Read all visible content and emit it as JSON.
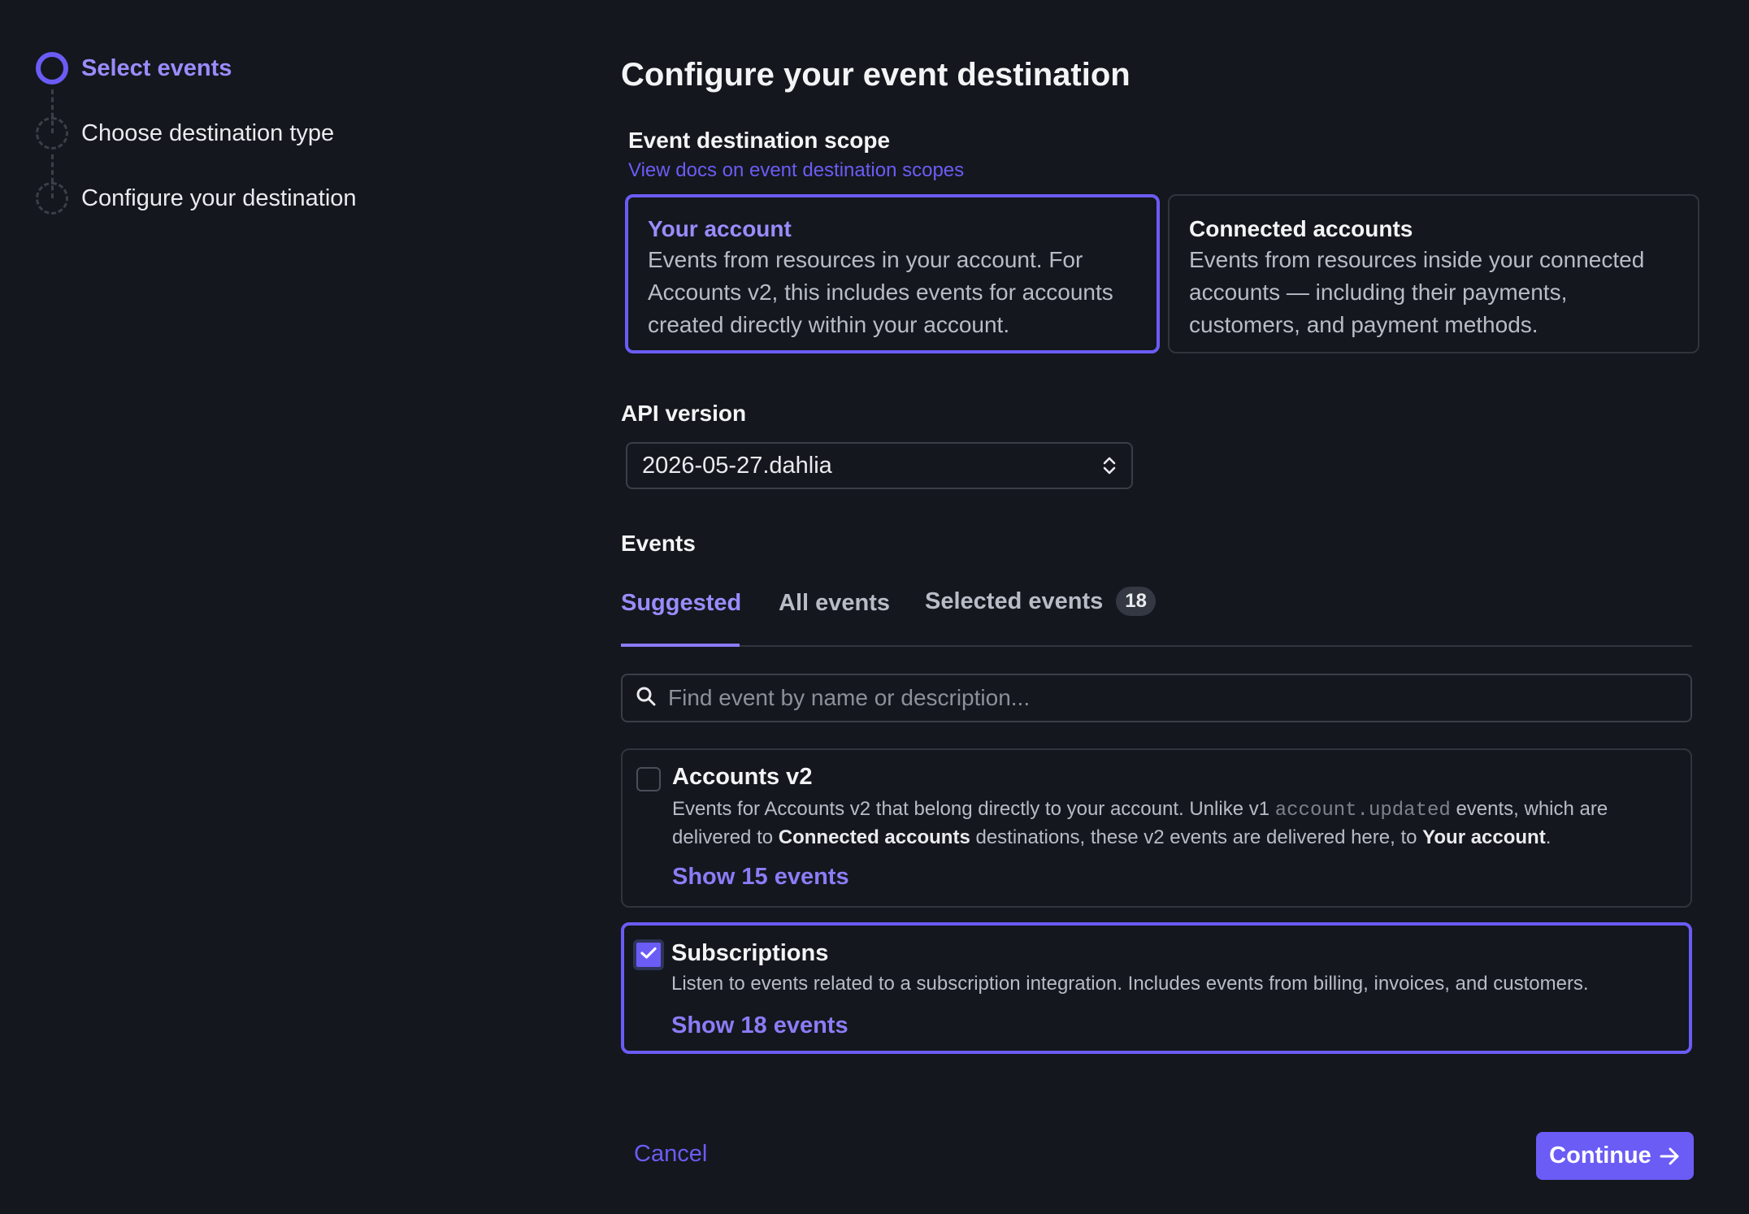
{
  "stepper": {
    "steps": [
      {
        "label": "Select events",
        "state": "active"
      },
      {
        "label": "Choose destination type",
        "state": "todo"
      },
      {
        "label": "Configure your destination",
        "state": "todo"
      }
    ]
  },
  "page": {
    "title": "Configure your event destination"
  },
  "scope": {
    "heading": "Event destination scope",
    "docs_link": "View docs on event destination scopes",
    "options": [
      {
        "title": "Your account",
        "description": "Events from resources in your account. For Accounts v2, this includes events for accounts created directly within your account.",
        "selected": true
      },
      {
        "title": "Connected accounts",
        "description": "Events from resources inside your connected accounts — including their payments, customers, and payment methods.",
        "selected": false
      }
    ]
  },
  "api_version": {
    "label": "API version",
    "value": "2026-05-27.dahlia"
  },
  "events": {
    "label": "Events",
    "tabs": [
      {
        "label": "Suggested",
        "active": true
      },
      {
        "label": "All events",
        "active": false
      },
      {
        "label": "Selected events",
        "active": false,
        "count": "18"
      }
    ],
    "search_placeholder": "Find event by name or description...",
    "groups": [
      {
        "title": "Accounts v2",
        "checked": false,
        "desc_part1": "Events for Accounts v2 that belong directly to your account. Unlike v1 ",
        "desc_code": "account.updated",
        "desc_part2": " events, which are delivered to ",
        "desc_bold1": "Connected accounts",
        "desc_part3": " destinations, these v2 events are delivered here, to ",
        "desc_bold2": "Your account",
        "desc_part4": ".",
        "show_link": "Show 15 events"
      },
      {
        "title": "Subscriptions",
        "checked": true,
        "description": "Listen to events related to a subscription integration. Includes events from billing, invoices, and customers.",
        "show_link": "Show 18 events"
      }
    ]
  },
  "footer": {
    "cancel": "Cancel",
    "continue": "Continue"
  },
  "colors": {
    "background": "#14171d",
    "accent": "#6b5cf6",
    "accent_text": "#9a8cff",
    "border": "#30343c"
  },
  "icons": [
    "step-active-icon",
    "step-todo-icon",
    "select-chevrons-icon",
    "search-icon",
    "checkmark-icon",
    "arrow-right-icon"
  ]
}
